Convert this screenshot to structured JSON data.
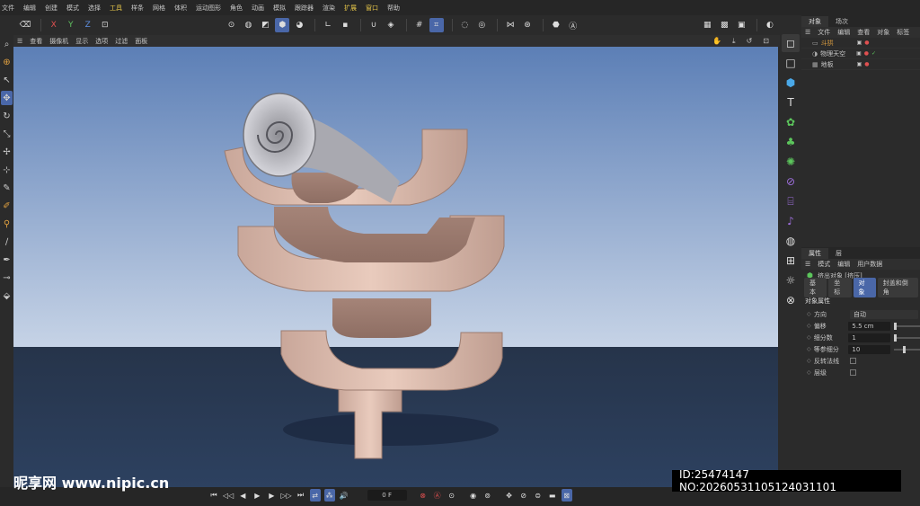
{
  "menubar": {
    "items": [
      "文件",
      "编辑",
      "创建",
      "模式",
      "选择",
      "工具",
      "样条",
      "网格",
      "体积",
      "运动图形",
      "角色",
      "动画",
      "模拟",
      "跟踪器",
      "渲染",
      "扩展",
      "窗口",
      "帮助"
    ]
  },
  "toolbar": {
    "axes": [
      "X",
      "Y",
      "Z"
    ]
  },
  "viewport": {
    "menu": [
      "查看",
      "摄像机",
      "显示",
      "选项",
      "过滤",
      "面板"
    ]
  },
  "object_manager": {
    "tabs": [
      "对象",
      "场次"
    ],
    "menu": [
      "文件",
      "编辑",
      "查看",
      "对象",
      "标签"
    ],
    "objects": [
      {
        "name": "斗拱",
        "selected": true
      },
      {
        "name": "物理天空",
        "selected": false
      },
      {
        "name": "地板",
        "selected": false
      }
    ]
  },
  "attributes": {
    "tabs": [
      "属性",
      "层"
    ],
    "menu": [
      "模式",
      "编辑",
      "用户数据"
    ],
    "object_path": "挤出对象 [挤压]",
    "subtabs": [
      "基本",
      "坐标",
      "对象",
      "封盖和倒角"
    ],
    "active_subtab": "对象",
    "section_title": "对象属性",
    "fields": [
      {
        "label": "方向",
        "value": "自动",
        "type": "dropdown"
      },
      {
        "label": "偏移",
        "value": "5.5 cm",
        "type": "number",
        "slider": 0.0
      },
      {
        "label": "细分数",
        "value": "1",
        "type": "number",
        "slider": 0.0
      },
      {
        "label": "等参细分",
        "value": "10",
        "type": "number",
        "slider": 0.35
      },
      {
        "label": "反转法线",
        "value": "",
        "type": "checkbox"
      },
      {
        "label": "层级",
        "value": "",
        "type": "checkbox"
      }
    ]
  },
  "timeline": {
    "frame": "0 F"
  },
  "watermark": {
    "site": "昵享网 www.nipic.cn",
    "id": "ID:25474147 NO:20260531105124031101"
  },
  "colors": {
    "accent": "#4a67a8",
    "sky_top": "#5c7fb6",
    "sky_bottom": "#c6d3e6",
    "floor": "#2a3c58",
    "object": "#dcbcae"
  }
}
